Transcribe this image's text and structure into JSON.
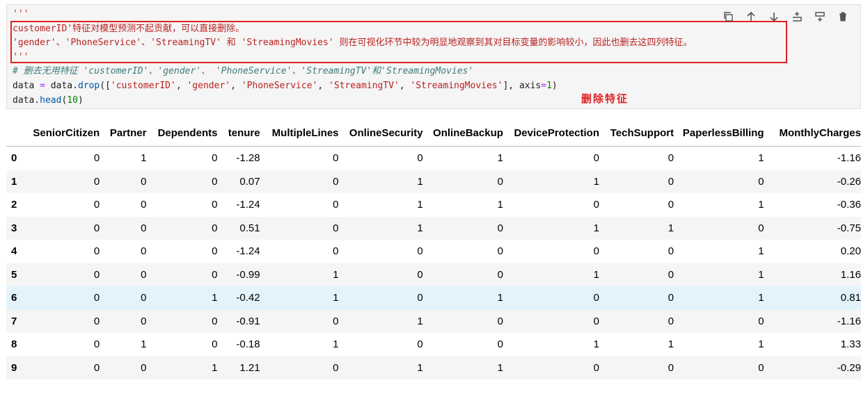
{
  "code_cell": {
    "lines": [
      [
        {
          "t": "'''",
          "c": "str"
        }
      ],
      [
        {
          "t": "customerID'特征对模型预测不起贡献，可以直接删除。",
          "c": "str"
        }
      ],
      [
        {
          "t": "'gender'、'PhoneService'、'StreamingTV' 和 'StreamingMovies' 则在可视化环节中较为明显地观察到其对目标变量的影响较小，因此也删去这四列特征。",
          "c": "str"
        }
      ],
      [
        {
          "t": "'''",
          "c": "str"
        }
      ],
      [
        {
          "t": "# 删去无用特征 'customerID'、'gender'、 'PhoneService'、'StreamingTV'和'StreamingMovies'",
          "c": "cmt"
        }
      ],
      [
        {
          "t": "data ",
          "c": ""
        },
        {
          "t": "=",
          "c": "kw"
        },
        {
          "t": " data.",
          "c": ""
        },
        {
          "t": "drop",
          "c": "fn"
        },
        {
          "t": "([",
          "c": ""
        },
        {
          "t": "'customerID'",
          "c": "str"
        },
        {
          "t": ", ",
          "c": ""
        },
        {
          "t": "'gender'",
          "c": "str"
        },
        {
          "t": ", ",
          "c": ""
        },
        {
          "t": "'PhoneService'",
          "c": "str"
        },
        {
          "t": ", ",
          "c": ""
        },
        {
          "t": "'StreamingTV'",
          "c": "str"
        },
        {
          "t": ", ",
          "c": ""
        },
        {
          "t": "'StreamingMovies'",
          "c": "str"
        },
        {
          "t": "], axis",
          "c": ""
        },
        {
          "t": "=",
          "c": "kw"
        },
        {
          "t": "1",
          "c": "num"
        },
        {
          "t": ")",
          "c": ""
        }
      ],
      [
        {
          "t": "data.",
          "c": ""
        },
        {
          "t": "head",
          "c": "fn"
        },
        {
          "t": "(",
          "c": ""
        },
        {
          "t": "10",
          "c": "num"
        },
        {
          "t": ")",
          "c": ""
        }
      ]
    ]
  },
  "annotation": "删除特征",
  "toolbar": {
    "icons": [
      "copy-icon",
      "move-up-icon",
      "move-down-icon",
      "insert-above-icon",
      "insert-below-icon",
      "delete-icon"
    ]
  },
  "table": {
    "columns": [
      "SeniorCitizen",
      "Partner",
      "Dependents",
      "tenure",
      "MultipleLines",
      "OnlineSecurity",
      "OnlineBackup",
      "DeviceProtection",
      "TechSupport",
      "PaperlessBilling",
      "MonthlyCharges"
    ],
    "rows": [
      {
        "index": "0",
        "values": [
          "0",
          "1",
          "0",
          "-1.28",
          "0",
          "0",
          "1",
          "0",
          "0",
          "1",
          "-1.16"
        ]
      },
      {
        "index": "1",
        "values": [
          "0",
          "0",
          "0",
          "0.07",
          "0",
          "1",
          "0",
          "1",
          "0",
          "0",
          "-0.26"
        ]
      },
      {
        "index": "2",
        "values": [
          "0",
          "0",
          "0",
          "-1.24",
          "0",
          "1",
          "1",
          "0",
          "0",
          "1",
          "-0.36"
        ]
      },
      {
        "index": "3",
        "values": [
          "0",
          "0",
          "0",
          "0.51",
          "0",
          "1",
          "0",
          "1",
          "1",
          "0",
          "-0.75"
        ]
      },
      {
        "index": "4",
        "values": [
          "0",
          "0",
          "0",
          "-1.24",
          "0",
          "0",
          "0",
          "0",
          "0",
          "1",
          "0.20"
        ]
      },
      {
        "index": "5",
        "values": [
          "0",
          "0",
          "0",
          "-0.99",
          "1",
          "0",
          "0",
          "1",
          "0",
          "1",
          "1.16"
        ]
      },
      {
        "index": "6",
        "values": [
          "0",
          "0",
          "1",
          "-0.42",
          "1",
          "0",
          "1",
          "0",
          "0",
          "1",
          "0.81"
        ]
      },
      {
        "index": "7",
        "values": [
          "0",
          "0",
          "0",
          "-0.91",
          "0",
          "1",
          "0",
          "0",
          "0",
          "0",
          "-1.16"
        ]
      },
      {
        "index": "8",
        "values": [
          "0",
          "1",
          "0",
          "-0.18",
          "1",
          "0",
          "0",
          "1",
          "1",
          "1",
          "1.33"
        ]
      },
      {
        "index": "9",
        "values": [
          "0",
          "0",
          "1",
          "1.21",
          "0",
          "1",
          "1",
          "0",
          "0",
          "0",
          "-0.29"
        ]
      }
    ],
    "hover_row": "6"
  }
}
